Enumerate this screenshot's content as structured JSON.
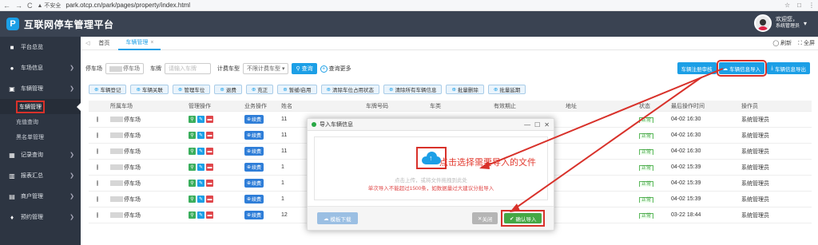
{
  "browser": {
    "back": "←",
    "forward": "→",
    "reload": "C",
    "security": "▲ 不安全",
    "url": "park.otcp.cn/park/pages/property/index.html",
    "right_icons": [
      "☆",
      "□",
      "⋮"
    ]
  },
  "header": {
    "logo_letter": "P",
    "title": "互联网停车管理平台",
    "welcome": "欢迎您，",
    "user": "系统管理员",
    "caret": "▾"
  },
  "sidebar": {
    "items": [
      {
        "icon": "■",
        "label": "平台总览"
      },
      {
        "icon": "●",
        "label": "车场信息",
        "chevron": "❯"
      },
      {
        "icon": "▣",
        "label": "车辆管理",
        "chevron": "❯"
      }
    ],
    "subitems": [
      {
        "label": "车辆管理"
      },
      {
        "label": "充值查询"
      },
      {
        "label": "黑名单管理"
      }
    ],
    "items2": [
      {
        "icon": "▦",
        "label": "记录查询",
        "chevron": "❯"
      },
      {
        "icon": "▥",
        "label": "报表汇总",
        "chevron": "❯"
      },
      {
        "icon": "▤",
        "label": "商户管理",
        "chevron": "❯"
      },
      {
        "icon": "♦",
        "label": "预约管理",
        "chevron": "❯"
      }
    ]
  },
  "tabs": {
    "back": "◁",
    "home": "首页",
    "active": "车辆管理",
    "close": "×",
    "refresh": "◯ 刷新",
    "fullscreen": "⛶ 全屏"
  },
  "filters": {
    "park_label": "停车场",
    "park_value": "停车场",
    "plate_label": "车牌",
    "plate_placeholder": "请输入车牌",
    "type_label": "计费车型",
    "type_value": "不限计费车型",
    "query": "查询",
    "more": "查询更多"
  },
  "top_buttons": [
    "车辆注册审核",
    "车辆信息导入",
    "车辆信息导出"
  ],
  "actions": [
    "车辆登记",
    "车辆关联",
    "管理车位",
    "退费",
    "充正",
    "暂缓/启用",
    "清除车位占用状态",
    "清除所有车辆信息",
    "批量删除",
    "批量延期"
  ],
  "table": {
    "headers": [
      "",
      "所属车场",
      "管理操作",
      "业务操作",
      "姓名",
      "车牌号码",
      "车类",
      "有效期止",
      "地址",
      "状态",
      "最后操作时间",
      "操作员"
    ],
    "renew": "续费",
    "rows": [
      {
        "park": "停车场",
        "name": "11",
        "status": "正常",
        "time": "04-02 16:30",
        "op": "系统管理员"
      },
      {
        "park": "停车场",
        "name": "11",
        "status": "正常",
        "time": "04-02 16:30",
        "op": "系统管理员"
      },
      {
        "park": "停车场",
        "name": "11",
        "status": "正常",
        "time": "04-02 16:30",
        "op": "系统管理员"
      },
      {
        "park": "停车场",
        "name": "1",
        "status": "正常",
        "time": "04-02 15:39",
        "op": "系统管理员"
      },
      {
        "park": "停车场",
        "name": "1",
        "status": "正常",
        "time": "04-02 15:39",
        "op": "系统管理员"
      },
      {
        "park": "停车场",
        "name": "1",
        "status": "正常",
        "time": "04-02 15:39",
        "op": "系统管理员"
      },
      {
        "park": "停车场",
        "name": "12",
        "status": "正常",
        "time": "03-22 18:44",
        "op": "系统管理员"
      }
    ]
  },
  "modal": {
    "title": "导入车辆信息",
    "ctrls": [
      "—",
      "☐",
      "✕"
    ],
    "hint": "点击上传，或将文件拖拽到此处",
    "limit": "单次导入不能超过1500条，如数据量过大建议分批导入",
    "template": "模板下载",
    "close": "关闭",
    "confirm": "确认导入"
  },
  "annotation": "点击选择需要导入的文件",
  "colors": {
    "primary": "#1c9fe6",
    "header": "#3a4352",
    "sidebar": "#2d3542",
    "highlight": "#d8312a",
    "confirm": "#45a845"
  }
}
